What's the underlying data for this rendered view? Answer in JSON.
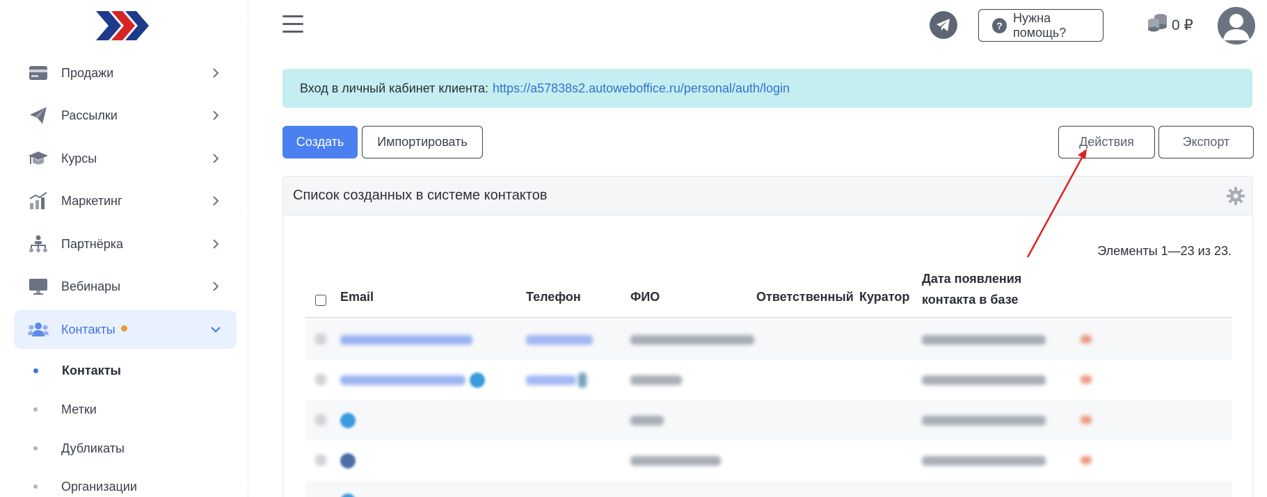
{
  "sidebar": {
    "items": [
      {
        "label": "Продажи",
        "icon": "wallet-icon"
      },
      {
        "label": "Рассылки",
        "icon": "paper-plane-icon"
      },
      {
        "label": "Курсы",
        "icon": "graduation-cap-icon"
      },
      {
        "label": "Маркетинг",
        "icon": "chart-growth-icon"
      },
      {
        "label": "Партнёрка",
        "icon": "org-structure-icon"
      },
      {
        "label": "Вебинары",
        "icon": "monitor-icon"
      },
      {
        "label": "Контакты",
        "icon": "users-icon"
      }
    ],
    "subitems": [
      {
        "label": "Контакты"
      },
      {
        "label": "Метки"
      },
      {
        "label": "Дубликаты"
      },
      {
        "label": "Организации"
      }
    ]
  },
  "header": {
    "help_label": "Нужна помощь?",
    "balance": "0 ₽"
  },
  "alert": {
    "text": "Вход в личный кабинет клиента:",
    "link": "https://a57838s2.autoweboffice.ru/personal/auth/login"
  },
  "toolbar": {
    "create": "Создать",
    "import": "Импортировать",
    "actions": "Действия",
    "export": "Экспорт"
  },
  "table": {
    "title": "Список созданных в системе контактов",
    "pager": "Элементы 1—23 из 23.",
    "columns": {
      "email": "Email",
      "phone": "Телефон",
      "name": "ФИО",
      "responsible": "Ответственный",
      "curator": "Куратор",
      "date_line1": "Дата появления",
      "date_line2": "контакта в базе"
    }
  },
  "colors": {
    "accent": "#4b80f0",
    "alert_bg": "#c4eef1",
    "active_nav_bg": "#eaf1fe",
    "annotation_arrow": "#e02020"
  }
}
